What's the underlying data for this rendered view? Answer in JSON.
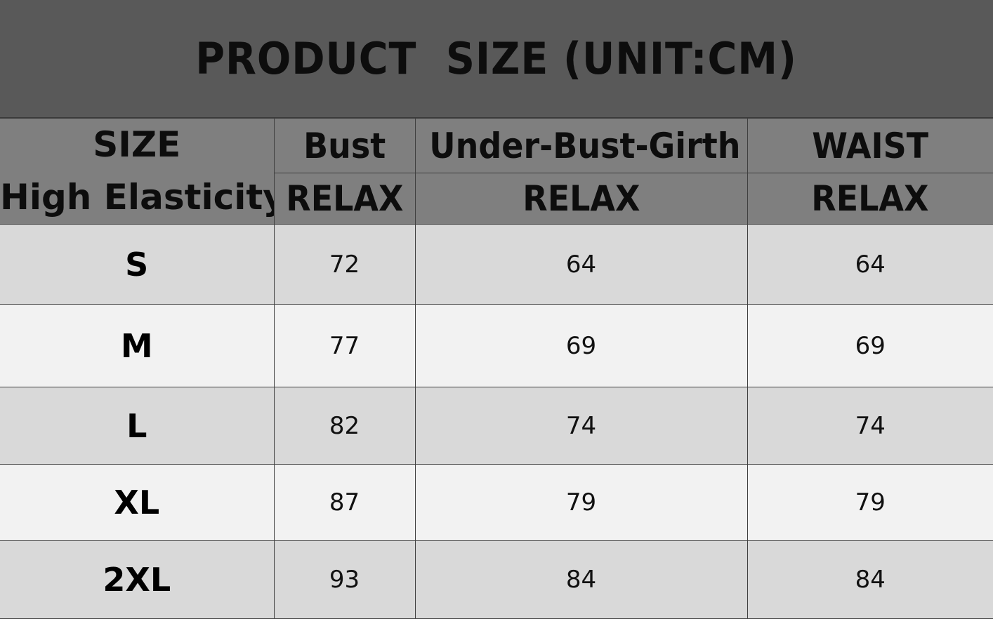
{
  "title": "PRODUCT  SIZE (UNIT:CM)",
  "header": {
    "size_label": "SIZE",
    "elasticity_label": "High Elasticity",
    "columns": [
      {
        "name": "Bust",
        "sub": "RELAX"
      },
      {
        "name": "Under-Bust-Girth",
        "sub": "RELAX"
      },
      {
        "name": "WAIST",
        "sub": "RELAX"
      }
    ]
  },
  "rows": [
    {
      "size": "S",
      "bust": "72",
      "under_bust_girth": "64",
      "waist": "64"
    },
    {
      "size": "M",
      "bust": "77",
      "under_bust_girth": "69",
      "waist": "69"
    },
    {
      "size": "L",
      "bust": "82",
      "under_bust_girth": "74",
      "waist": "74"
    },
    {
      "size": "XL",
      "bust": "87",
      "under_bust_girth": "79",
      "waist": "79"
    },
    {
      "size": "2XL",
      "bust": "93",
      "under_bust_girth": "84",
      "waist": "84"
    }
  ],
  "colors": {
    "title_bg": "#595959",
    "header_bg": "#7f7f7f",
    "row_dark": "#d9d9d9",
    "row_light": "#f2f2f2",
    "border": "#3f3f3f"
  }
}
